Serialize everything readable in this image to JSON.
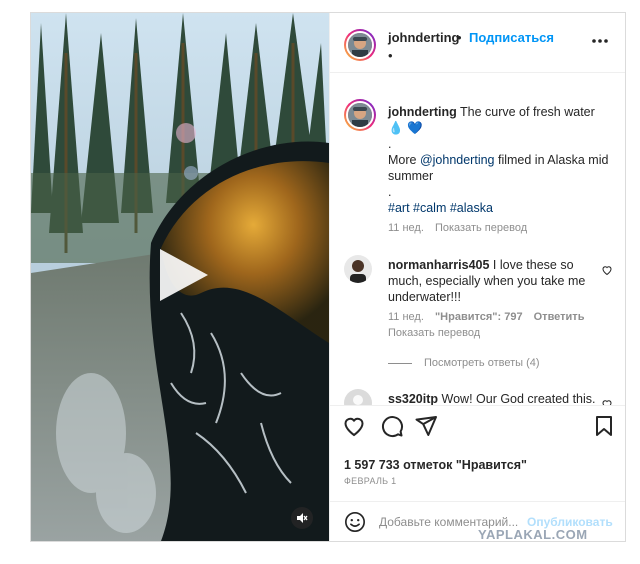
{
  "header": {
    "username": "johnderting",
    "dot": "•",
    "follow_label": "Подписаться",
    "second_line": "•"
  },
  "caption": {
    "username": "johnderting",
    "line1": "The curve of fresh water",
    "emoji": "💧 💙",
    "dot1": ".",
    "more_prefix": "More ",
    "mention": "@johnderting",
    "more_suffix": " filmed in Alaska mid summer",
    "dot2": ".",
    "hashtags": "#art #calm #alaska",
    "time": "11 нед.",
    "translate": "Показать перевод"
  },
  "comments": [
    {
      "username": "normanharris405",
      "text": "I love these so much, especially when you take me underwater!!!",
      "time": "11 нед.",
      "likes": "\"Нравится\": 797",
      "reply": "Ответить",
      "translate": "Показать перевод",
      "view_replies": "Посмотреть ответы (4)"
    },
    {
      "username": "ss320itp",
      "text": "Wow! Our God created this. Then He created You. If you're"
    }
  ],
  "stats": {
    "likes": "1 597 733 отметок \"Нравится\"",
    "date": "ФЕВРАЛЬ 1"
  },
  "add_comment": {
    "placeholder": "Добавьте комментарий...",
    "post_label": "Опубликовать"
  },
  "icons": {
    "play": "play-icon",
    "mute": "speaker-muted-icon",
    "more": "more-horizontal-icon",
    "like": "heart-icon",
    "comment": "comment-icon",
    "share": "paper-plane-icon",
    "save": "bookmark-icon",
    "emoji": "smiley-icon"
  },
  "colors": {
    "accent": "#0095f6",
    "link": "#00376b",
    "muted": "#8e8e8e",
    "post_disabled": "#b2dffc"
  },
  "watermark": "YAPLAKAL.COM"
}
